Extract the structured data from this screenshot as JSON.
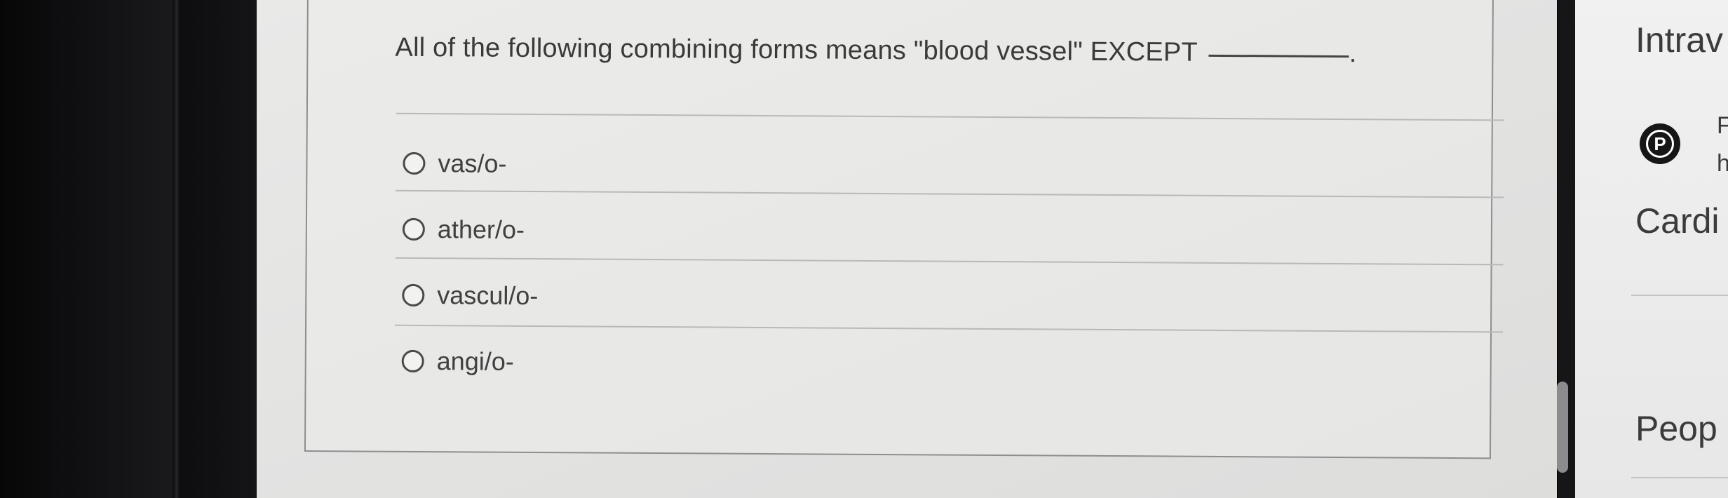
{
  "question": {
    "text": "All of the following combining forms means \"blood vessel\" EXCEPT",
    "end_punct": "."
  },
  "options": [
    {
      "label": "vas/o-"
    },
    {
      "label": "ather/o-"
    },
    {
      "label": "vascul/o-"
    },
    {
      "label": "angi/o-"
    }
  ],
  "sidebar": {
    "heading_1": "Intrav",
    "pearson_line_1": "F",
    "pearson_line_2": "h",
    "heading_2": "Cardi",
    "heading_3": "Peop"
  },
  "colors": {
    "page_bg": "#e6e6e5",
    "bezel": "#0c0c0d",
    "text": "#3a3a3a"
  },
  "icons": {
    "option_marker": "radio-circle",
    "sidebar_brand": "pearson-logo-icon"
  }
}
